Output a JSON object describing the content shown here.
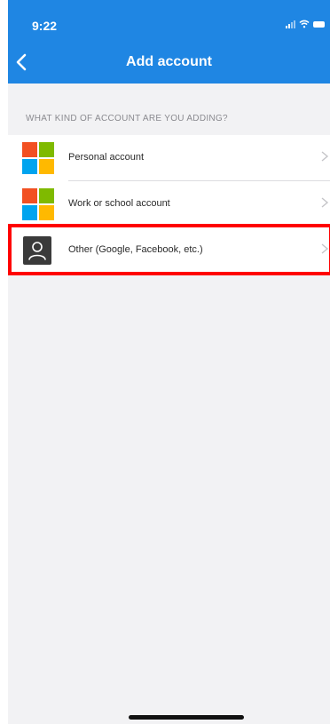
{
  "status_bar": {
    "time": "9:22",
    "icons": [
      "signal-icon",
      "wifi-icon",
      "battery-icon"
    ]
  },
  "header": {
    "title": "Add account",
    "back_icon": "chevron-left-icon",
    "background_color": "#1f86e3"
  },
  "section": {
    "header": "WHAT KIND OF ACCOUNT ARE YOU ADDING?"
  },
  "accounts": [
    {
      "label": "Personal account",
      "icon": "microsoft-logo-icon"
    },
    {
      "label": "Work or school account",
      "icon": "microsoft-logo-icon"
    },
    {
      "label": "Other (Google, Facebook, etc.)",
      "icon": "person-icon"
    }
  ],
  "colors": {
    "ms_red": "#f25022",
    "ms_green": "#7fba00",
    "ms_blue": "#00a4ef",
    "ms_yellow": "#ffb900",
    "highlight": "#ff0000"
  }
}
